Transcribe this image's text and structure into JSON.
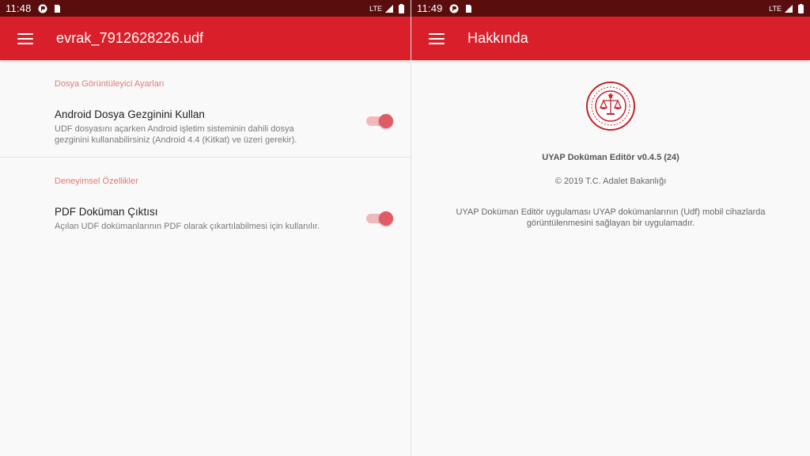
{
  "left": {
    "status": {
      "time": "11:48",
      "network": "LTE"
    },
    "appbar": {
      "title": "evrak_7912628226.udf"
    },
    "sections": [
      {
        "header": "Dosya Görüntüleyici Ayarları",
        "pref": {
          "title": "Android Dosya Gezginini Kullan",
          "summary": "UDF dosyasını açarken Android işletim sisteminin dahili dosya gezginini kullanabilirsiniz (Android 4.4 (Kitkat) ve üzeri gerekir).",
          "enabled": true
        }
      },
      {
        "header": "Deneyimsel Özellikler",
        "pref": {
          "title": "PDF Doküman Çıktısı",
          "summary": "Açılan UDF dokümanlarının PDF olarak çıkartılabilmesi için kullanılır.",
          "enabled": true
        }
      }
    ]
  },
  "right": {
    "status": {
      "time": "11:49",
      "network": "LTE"
    },
    "appbar": {
      "title": "Hakkında"
    },
    "about": {
      "app_name": "UYAP Doküman Editör v0.4.5 (24)",
      "copyright": "© 2019 T.C. Adalet Bakanlığı",
      "description": "UYAP Doküman Editör uygulaması UYAP dokümanlarının (Udf) mobil cihazlarda görüntülenmesini sağlayan bir uygulamadır."
    }
  },
  "icons": {
    "status_left": [
      "notification-icon",
      "sim-card-icon"
    ],
    "status_right": [
      "signal-icon",
      "battery-icon"
    ],
    "menu": "menu-icon",
    "logo": "ministry-seal-logo"
  },
  "colors": {
    "status_bar": "#5a0d0d",
    "app_bar": "#d9202a",
    "section_header": "#e07a7a",
    "switch_thumb": "#e05b63",
    "switch_track": "#f2b8bc",
    "seal_red": "#c8202a"
  }
}
